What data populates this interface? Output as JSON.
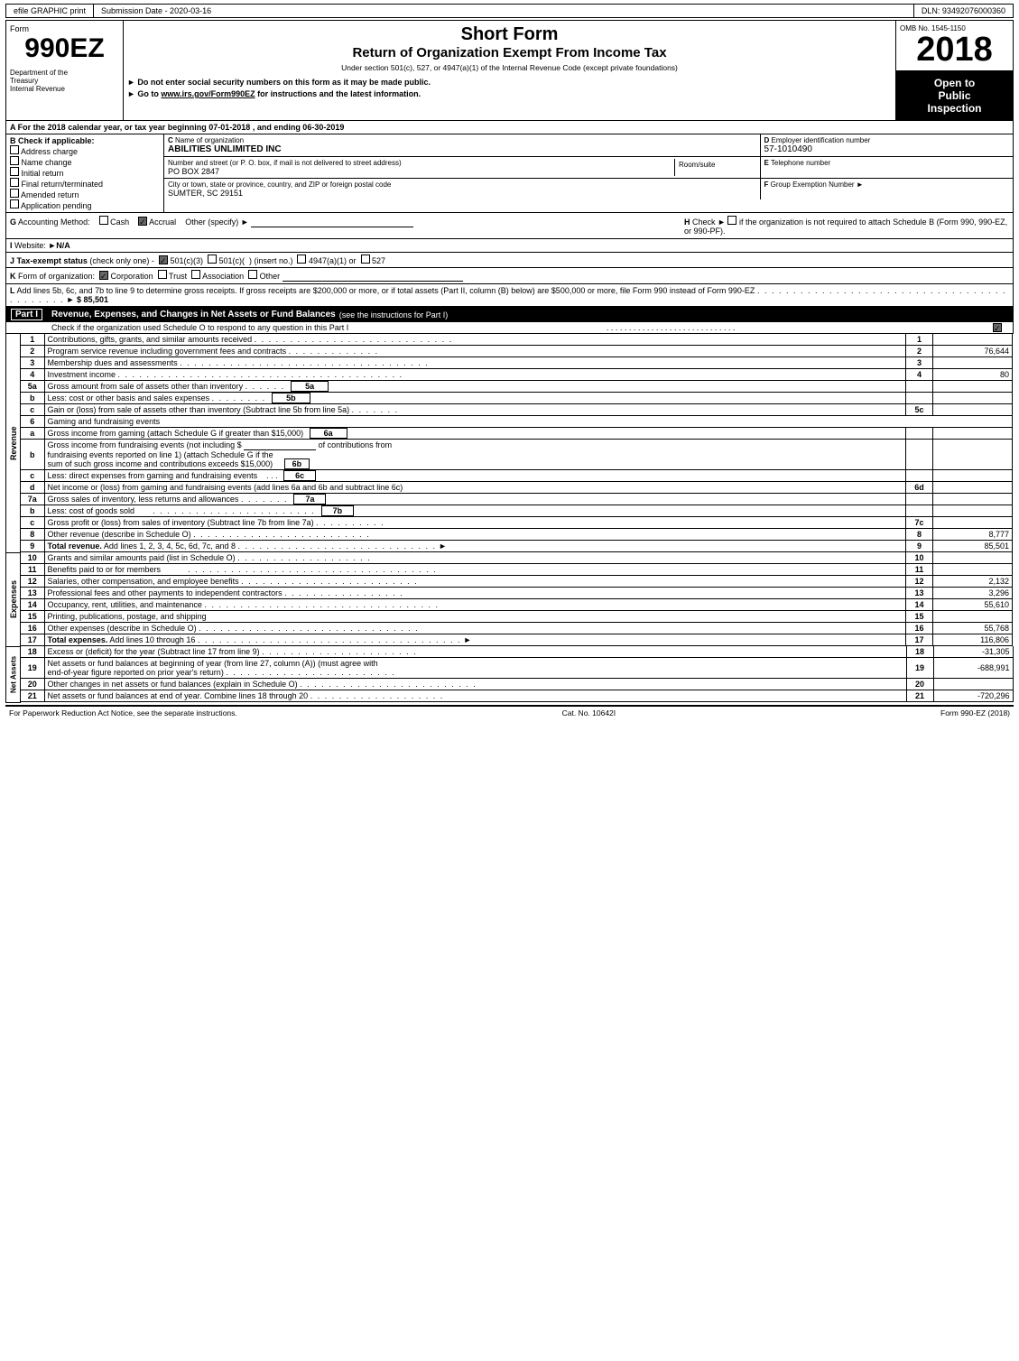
{
  "header": {
    "efile_label": "efile GRAPHIC print",
    "submission_label": "Submission Date - 2020-03-16",
    "dln_label": "DLN: 93492076000360"
  },
  "form_id": {
    "form_label": "Form",
    "form_number": "990EZ",
    "dept_line1": "Department of the",
    "dept_line2": "Treasury",
    "dept_line3": "Internal Revenue"
  },
  "titles": {
    "short_form": "Short Form",
    "main_title": "Return of Organization Exempt From Income Tax",
    "subtitle": "Under section 501(c), 527, or 4947(a)(1) of the Internal Revenue Code (except private foundations)",
    "instruction1": "► Do not enter social security numbers on this form as it may be made public.",
    "instruction2": "► Go to www.irs.gov/Form990EZ for instructions and the latest information."
  },
  "year_block": {
    "omb": "OMB No. 1545-1150",
    "year": "2018",
    "open_line1": "Open to",
    "open_line2": "Public",
    "open_line3": "Inspection"
  },
  "section_a": {
    "label": "A",
    "text": "For the 2018 calendar year, or tax year beginning 07-01-2018",
    "ending": ", and ending 06-30-2019"
  },
  "section_b": {
    "label": "B",
    "title": "Check if applicable:",
    "items": [
      {
        "label": "Address charge",
        "checked": false
      },
      {
        "label": "Name change",
        "checked": false
      },
      {
        "label": "Initial return",
        "checked": false
      },
      {
        "label": "Final return/terminated",
        "checked": false
      },
      {
        "label": "Amended return",
        "checked": false
      },
      {
        "label": "Application pending",
        "checked": false
      }
    ]
  },
  "org_info": {
    "c_label": "C",
    "name_label": "Name of organization",
    "name_value": "ABILITIES UNLIMITED INC",
    "d_label": "D",
    "ein_label": "Employer identification number",
    "ein_value": "57-1010490",
    "address_label": "Number and street (or P. O. box, if mail is not delivered to street address)",
    "address_value": "PO BOX 2847",
    "room_label": "Room/suite",
    "room_value": "",
    "e_label": "E",
    "phone_label": "Telephone number",
    "phone_value": "",
    "city_label": "City or town, state or province, country, and ZIP or foreign postal code",
    "city_value": "SUMTER, SC  29151",
    "f_label": "F",
    "group_label": "Group Exemption Number",
    "group_arrow": "►"
  },
  "acct": {
    "g_label": "G",
    "g_text": "Accounting Method:",
    "cash_label": "Cash",
    "accrual_label": "Accrual",
    "accrual_checked": true,
    "other_label": "Other (specify) ►",
    "h_label": "H",
    "h_text": "Check ►",
    "h_rest": "if the organization is not required to attach Schedule B (Form 990, 990-EZ, or 990-PF)."
  },
  "website": {
    "i_label": "I",
    "label": "Website: ►",
    "value": "N/A"
  },
  "tax_status": {
    "j_label": "J",
    "text": "Tax-exempt status",
    "check_text": "(check only one) -",
    "option1": "501(c)(3)",
    "option1_checked": true,
    "option2": "501(c)(  )",
    "option2_checked": false,
    "insert_text": "(insert no.)",
    "option3": "4947(a)(1) or",
    "option3_checked": false,
    "option4": "527",
    "option4_checked": false
  },
  "form_org": {
    "k_label": "K",
    "text": "Form of organization:",
    "corp_label": "Corporation",
    "corp_checked": true,
    "trust_label": "Trust",
    "trust_checked": false,
    "assoc_label": "Association",
    "assoc_checked": false,
    "other_label": "Other"
  },
  "add_lines": {
    "l_label": "L",
    "text": "Add lines 5b, 6c, and 7b to line 9 to determine gross receipts. If gross receipts are $200,000 or more, or if total assets (Part II, column (B) below) are $500,000 or more, file Form 990 instead of Form 990-EZ",
    "dots": ". . . . . . . . . . . . . . . . . . . . . . . . . . . . . . . . . . . . . . . . . . .",
    "arrow": "►",
    "amount": "$ 85,501"
  },
  "part1": {
    "label": "Part I",
    "title": "Revenue, Expenses, and Changes in Net Assets or Fund Balances",
    "title_note": "(see the instructions for Part I)",
    "schedule_o_text": "Check if the organization used Schedule O to respond to any question in this Part I",
    "schedule_o_dots": ". . . . . . . . . . . . . . . . . . . . . . . . . . . . .",
    "schedule_o_checked": true
  },
  "revenue_section": {
    "label": "Revenue",
    "rows": [
      {
        "num": "1",
        "desc": "Contributions, gifts, grants, and similar amounts received",
        "dots": ". . . . . . . . . . . . . . . . . . . . . . . . . . . .",
        "box": "1",
        "amount": ""
      },
      {
        "num": "2",
        "desc": "Program service revenue including government fees and contracts",
        "dots": ". . . . . . . . . . . . . .",
        "box": "2",
        "amount": "76,644"
      },
      {
        "num": "3",
        "desc": "Membership dues and assessments",
        "dots": ". . . . . . . . . . . . . . . . . . . . . . . . . . . . . . . . . . .",
        "box": "3",
        "amount": ""
      },
      {
        "num": "4",
        "desc": "Investment income",
        "dots": ". . . . . . . . . . . . . . . . . . . . . . . . . . . . . . . . . . . . . . . .",
        "box": "4",
        "amount": "80"
      },
      {
        "num": "5a",
        "desc": "Gross amount from sale of assets other than inventory",
        "dots": ". . . . . .",
        "box": "5a",
        "amount": ""
      },
      {
        "num": "b",
        "desc": "Less: cost or other basis and sales expenses",
        "dots": ". . . . . . . .",
        "box": "5b",
        "amount": ""
      },
      {
        "num": "c",
        "desc": "Gain or (loss) from sale of assets other than inventory (Subtract line 5b from line 5a)",
        "dots": ". . . . . . .",
        "box": "5c",
        "amount": ""
      },
      {
        "num": "6",
        "desc": "Gaming and fundraising events",
        "dots": "",
        "box": "",
        "amount": ""
      },
      {
        "num": "a",
        "desc": "Gross income from gaming (attach Schedule G if greater than $15,000)",
        "dots": "",
        "box": "6a",
        "amount": ""
      },
      {
        "num": "b",
        "desc": "Gross income from fundraising events (not including $",
        "dots": "",
        "of_text": "of contributions from",
        "box": "6b",
        "amount": "",
        "extra_lines": [
          "fundraising events reported on line 1) (attach Schedule G if the",
          "sum of such gross income and contributions exceeds $15,000)"
        ]
      },
      {
        "num": "c",
        "desc": "Less: direct expenses from gaming and fundraising events",
        "dots": ". . .",
        "box": "6c",
        "amount": ""
      },
      {
        "num": "d",
        "desc": "Net income or (loss) from gaming and fundraising events (add lines 6a and 6b and subtract line 6c)",
        "dots": "",
        "box": "6d",
        "amount": ""
      },
      {
        "num": "7a",
        "desc": "Gross sales of inventory, less returns and allowances",
        "dots": ". . . . . . .",
        "box": "7a",
        "amount": ""
      },
      {
        "num": "b",
        "desc": "Less: cost of goods sold",
        "dots": ". . . . . . . . . . . . . . . . . . . . . . .",
        "box": "7b",
        "amount": ""
      },
      {
        "num": "c",
        "desc": "Gross profit or (loss) from sales of inventory (Subtract line 7b from line 7a)",
        "dots": ". . . . . . . . . .",
        "box": "7c",
        "amount": ""
      },
      {
        "num": "8",
        "desc": "Other revenue (describe in Schedule O)",
        "dots": ". . . . . . . . . . . . . . . . . . . . . . . . .",
        "box": "8",
        "amount": "8,777"
      },
      {
        "num": "9",
        "desc": "Total revenue. Add lines 1, 2, 3, 4, 5c, 6d, 7c, and 8",
        "dots": ". . . . . . . . . . . . . . . . . . . . . . . . . . . .",
        "bold": true,
        "arrow": "►",
        "box": "9",
        "amount": "85,501"
      }
    ]
  },
  "expenses_section": {
    "label": "Expenses",
    "rows": [
      {
        "num": "10",
        "desc": "Grants and similar amounts paid (list in Schedule O)",
        "dots": ". . . . . . . . . . . . . . . . . . .",
        "box": "10",
        "amount": ""
      },
      {
        "num": "11",
        "desc": "Benefits paid to or for members",
        "dots": ". . . . . . . . . . . . . . . . . . . . . . . . . . . . . . . . . . .",
        "box": "11",
        "amount": ""
      },
      {
        "num": "12",
        "desc": "Salaries, other compensation, and employee benefits",
        "dots": ". . . . . . . . . . . . . . . . . . . . . . . . . .",
        "box": "12",
        "amount": "2,132"
      },
      {
        "num": "13",
        "desc": "Professional fees and other payments to independent contractors",
        "dots": ". . . . . . . . . . . . . . . . . .",
        "box": "13",
        "amount": "3,296"
      },
      {
        "num": "14",
        "desc": "Occupancy, rent, utilities, and maintenance",
        "dots": ". . . . . . . . . . . . . . . . . . . . . . . . . . . . . . . . .",
        "box": "14",
        "amount": "55,610"
      },
      {
        "num": "15",
        "desc": "Printing, publications, postage, and shipping",
        "dots": "",
        "box": "15",
        "amount": ""
      },
      {
        "num": "16",
        "desc": "Other expenses (describe in Schedule O)",
        "dots": ". . . . . . . . . . . . . . . . . . . . . . . . . . . . . . .",
        "box": "16",
        "amount": "55,768"
      },
      {
        "num": "17",
        "desc": "Total expenses. Add lines 10 through 16",
        "dots": ". . . . . . . . . . . . . . . . . . . . . . . . . . . . . . . . . . . . .",
        "bold": true,
        "arrow": "►",
        "box": "17",
        "amount": "116,806"
      }
    ]
  },
  "net_assets_section": {
    "label": "Net Assets",
    "rows": [
      {
        "num": "18",
        "desc": "Excess or (deficit) for the year (Subtract line 17 from line 9)",
        "dots": ". . . . . . . . . . . . . . . . . . . . . .",
        "box": "18",
        "amount": "-31,305"
      },
      {
        "num": "19",
        "desc": "Net assets or fund balances at beginning of year (from line 27, column (A)) (must agree with end-of-year figure reported on prior year's return)",
        "dots": ". . . . . . . . . . . . . . . . . . . . . . . .",
        "box": "19",
        "amount": "-688,991"
      },
      {
        "num": "20",
        "desc": "Other changes in net assets or fund balances (explain in Schedule O)",
        "dots": ". . . . . . . . . . . . . . . . . . . . . . . . . .",
        "box": "20",
        "amount": ""
      },
      {
        "num": "21",
        "desc": "Net assets or fund balances at end of year. Combine lines 18 through 20",
        "dots": ". . . . . . . . . . . . . . . . . . . .",
        "box": "21",
        "amount": "-720,296"
      }
    ]
  },
  "footer": {
    "left": "For Paperwork Reduction Act Notice, see the separate instructions.",
    "center": "Cat. No. 10642I",
    "right": "Form 990-EZ (2018)"
  }
}
